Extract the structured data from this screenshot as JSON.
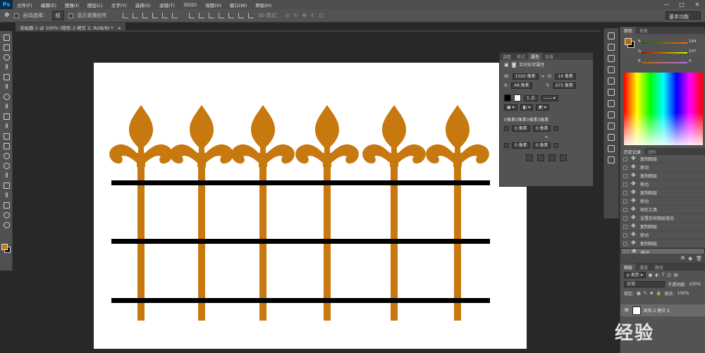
{
  "app": {
    "logo": "Ps"
  },
  "menu": [
    "文件(F)",
    "编辑(E)",
    "图像(I)",
    "图层(L)",
    "文字(Y)",
    "选择(S)",
    "滤镜(T)",
    "3D(D)",
    "视图(V)",
    "窗口(W)",
    "帮助(H)"
  ],
  "window_controls": [
    "—",
    "□",
    "✕"
  ],
  "options_bar": {
    "auto_select_label": "自动选择：",
    "auto_select_value": "组",
    "show_transform_label": "显示变换控件",
    "mode_3d_label": "3D 模式：",
    "workspace": "基本功能"
  },
  "document_tab": "未标题-1 @ 100% (矩形 2 拷贝 2, RGB/8) *",
  "canvas": {
    "background": "#ffffff",
    "ornament_color": "#c7780f",
    "rail_color": "#000000",
    "ornament_count": 6
  },
  "properties": {
    "tabs": [
      "调整",
      "样式",
      "属性",
      "信息"
    ],
    "active_tab": 2,
    "title": "实时形状属性",
    "w_label": "W:",
    "w_value": "1020 像素",
    "h_label": "H:",
    "h_value": "14 像素",
    "x_label": "X:",
    "x_value": "48 像素",
    "y_label": "Y:",
    "y_value": "475 像素",
    "stroke_width": "1 点",
    "corner_summary": "0像素0像素0像素0像素",
    "corner_values": [
      "0 像素",
      "0 像素",
      "0 像素",
      "0 像素"
    ],
    "fill_color": "#000000"
  },
  "color_panel": {
    "tabs": [
      "颜色",
      "色板"
    ],
    "active_tab": 0,
    "channels": [
      {
        "label": "R",
        "value": "184",
        "color": "#d23c3c"
      },
      {
        "label": "G",
        "value": "107",
        "color": "#3ca83c"
      },
      {
        "label": "B",
        "value": "6",
        "color": "#3c5cd2"
      }
    ]
  },
  "history": {
    "tabs": [
      "历史记录",
      "动作"
    ],
    "active_tab": 0,
    "items": [
      "复制图层",
      "移动",
      "复制图层",
      "移动",
      "复制图层",
      "移动",
      "矩形工具",
      "设置形状图层填充",
      "复制图层",
      "移动",
      "复制图层",
      "移动"
    ],
    "selected_index": 11
  },
  "layers": {
    "tabs": [
      "图层",
      "通道",
      "路径"
    ],
    "active_tab": 0,
    "filter_label": "类型",
    "blend_mode": "正常",
    "opacity_label": "不透明度:",
    "opacity_value": "100%",
    "lock_label": "锁定:",
    "fill_label": "填充:",
    "fill_value": "100%",
    "selected_layer": "矩形 2 拷贝 2"
  },
  "watermark": "经验"
}
